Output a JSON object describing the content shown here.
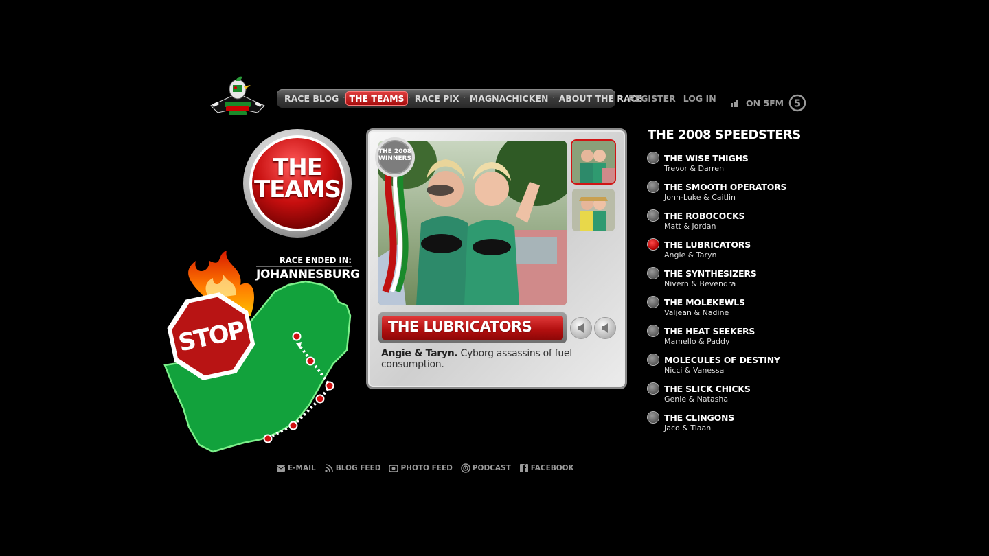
{
  "nav": {
    "items": [
      {
        "label": "RACE BLOG"
      },
      {
        "label": "THE TEAMS"
      },
      {
        "label": "RACE PIX"
      },
      {
        "label": "MAGNACHICKEN"
      },
      {
        "label": "ABOUT THE RACE"
      }
    ],
    "active_index": 1
  },
  "auth": {
    "register": "REGISTER",
    "login": "LOG IN"
  },
  "radio": {
    "label": "ON 5FM"
  },
  "hero": {
    "title_line1": "THE",
    "title_line2": "TEAMS"
  },
  "race": {
    "ended_label": "RACE ENDED IN:",
    "city": "JOHANNESBURG",
    "stop_sign": "STOP"
  },
  "feature": {
    "badge_line1": "THE 2008",
    "badge_line2": "WINNERS",
    "team_name": "THE LUBRICATORS",
    "members": "Angie & Taryn.",
    "description": "Cyborg assassins of fuel consumption."
  },
  "list": {
    "title": "THE 2008 SPEEDSTERS",
    "active_index": 3,
    "teams": [
      {
        "name": "THE WISE THIGHS",
        "members": "Trevor & Darren"
      },
      {
        "name": "THE SMOOTH OPERATORS",
        "members": "John-Luke & Caitlin"
      },
      {
        "name": "THE ROBOCOCKS",
        "members": "Matt & Jordan"
      },
      {
        "name": "THE LUBRICATORS",
        "members": "Angie & Taryn"
      },
      {
        "name": "THE SYNTHESIZERS",
        "members": "Nivern & Bevendra"
      },
      {
        "name": "THE MOLEKEWLS",
        "members": "Valjean & Nadine"
      },
      {
        "name": "THE HEAT SEEKERS",
        "members": "Mamello & Paddy"
      },
      {
        "name": "MOLECULES OF DESTINY",
        "members": "Nicci & Vanessa"
      },
      {
        "name": "THE SLICK CHICKS",
        "members": "Genie & Natasha"
      },
      {
        "name": "THE CLINGONS",
        "members": "Jaco & Tiaan"
      }
    ]
  },
  "footer": {
    "links": [
      {
        "label": "E-MAIL",
        "icon": "email-icon"
      },
      {
        "label": "BLOG FEED",
        "icon": "rss-icon"
      },
      {
        "label": "PHOTO FEED",
        "icon": "camera-icon"
      },
      {
        "label": "PODCAST",
        "icon": "podcast-icon"
      },
      {
        "label": "FACEBOOK",
        "icon": "facebook-icon"
      }
    ]
  },
  "colors": {
    "accent_red": "#c41212",
    "map_green": "#11a03a",
    "text_grey": "#9a9a9a"
  }
}
